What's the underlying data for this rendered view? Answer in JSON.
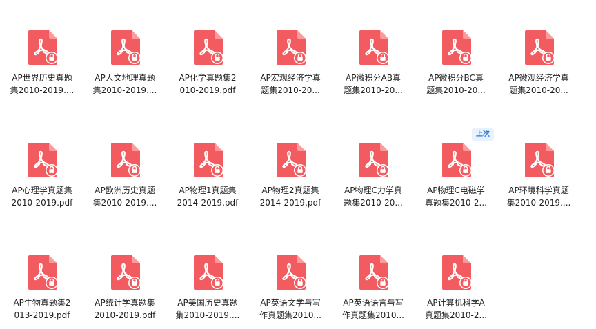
{
  "colors": {
    "pdf_icon": "#f25b5f",
    "pdf_icon_fold": "#ff9a9c",
    "badge_text": "#2a7ad6",
    "badge_bg": "#e8f2fd"
  },
  "icons": {
    "file": "pdf-file-icon",
    "lock": "lock-icon"
  },
  "badge": {
    "label": "上次"
  },
  "files": [
    {
      "line1": "AP世界历史真题",
      "line2": "集2010-2019...."
    },
    {
      "line1": "AP人文地理真题",
      "line2": "集2010-2019...."
    },
    {
      "line1": "AP化学真题集2",
      "line2": "010-2019.pdf"
    },
    {
      "line1": "AP宏观经济学真",
      "line2": "题集2010-20..."
    },
    {
      "line1": "AP微积分AB真",
      "line2": "题集2010-20..."
    },
    {
      "line1": "AP微积分BC真",
      "line2": "题集2010-20..."
    },
    {
      "line1": "AP微观经济学真",
      "line2": "题集2010-20..."
    },
    {
      "line1": "AP心理学真题集",
      "line2": "2010-2019.pdf"
    },
    {
      "line1": "AP欧洲历史真题",
      "line2": "集2010-2019...."
    },
    {
      "line1": "AP物理1真题集",
      "line2": "2014-2019.pdf"
    },
    {
      "line1": "AP物理2真题集",
      "line2": "2014-2019.pdf"
    },
    {
      "line1": "AP物理C力学真",
      "line2": "题集2010-20..."
    },
    {
      "line1": "AP物理C电磁学",
      "line2": "真题集2010-2..."
    },
    {
      "line1": "AP环境科学真题",
      "line2": "集2010-2019...."
    },
    {
      "line1": "AP生物真题集2",
      "line2": "013-2019.pdf"
    },
    {
      "line1": "AP统计学真题集",
      "line2": "2010-2019.pdf"
    },
    {
      "line1": "AP美国历史真题",
      "line2": "集2010-2019...."
    },
    {
      "line1": "AP英语文学与写",
      "line2": "作真题集2010..."
    },
    {
      "line1": "AP英语语言与写",
      "line2": "作真题集2010..."
    },
    {
      "line1": "AP计算机科学A",
      "line2": "真题集2010-2..."
    }
  ]
}
